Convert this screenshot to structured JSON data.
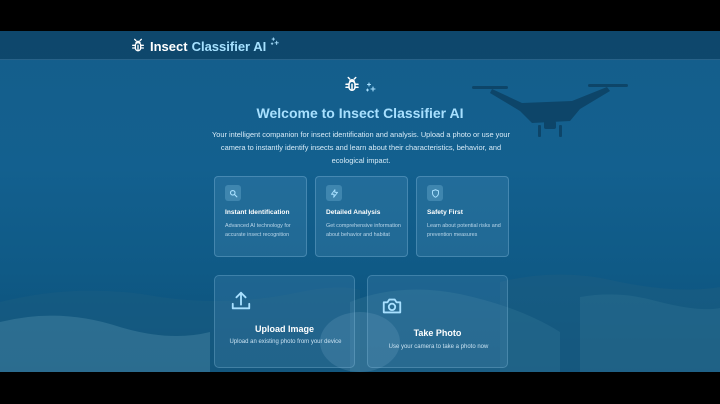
{
  "navbar": {
    "brand_primary": "Insect",
    "brand_accent": "Classifier AI"
  },
  "hero": {
    "title": "Welcome to Insect Classifier AI",
    "description": "Your intelligent companion for insect identification and analysis. Upload a photo or use your camera to instantly identify insects and learn about their characteristics, behavior, and ecological impact."
  },
  "features": [
    {
      "icon": "search-icon",
      "title": "Instant Identification",
      "description": "Advanced AI technology for accurate insect recognition"
    },
    {
      "icon": "lightning-icon",
      "title": "Detailed Analysis",
      "description": "Get comprehensive information about behavior and habitat"
    },
    {
      "icon": "shield-icon",
      "title": "Safety First",
      "description": "Learn about potential risks and prevention measures"
    }
  ],
  "actions": {
    "upload": {
      "icon": "upload-icon",
      "title": "Upload Image",
      "description": "Upload an existing photo from your device"
    },
    "camera": {
      "icon": "camera-icon",
      "title": "Take Photo",
      "description": "Use your camera to take a photo now"
    }
  },
  "colors": {
    "accent": "#a8e0ff",
    "background": "#155e8b",
    "card": "#4d8db8"
  }
}
